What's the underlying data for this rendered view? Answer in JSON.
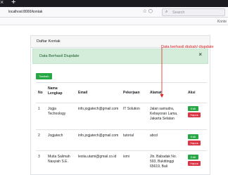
{
  "browser": {
    "tab_close": "×",
    "new_tab": "+",
    "url": "localhost:8000/kontak",
    "search_placeholder": "Search",
    "bookmark_label": "Konte",
    "url_icons": "☆ ⬡"
  },
  "page": {
    "card_title": "Daftar Kontak",
    "alert_text": "Data Berhasil Diupdate",
    "alert_close": "×",
    "add_button": "Tambah",
    "columns": [
      "No",
      "Nama Lengkap",
      "Email",
      "Pekerjaan",
      "Alamat",
      "Aksi"
    ],
    "rows": [
      {
        "no": "1",
        "nama": [
          "Jogja",
          "Technology"
        ],
        "email": "info.jogjatech@gmail.com",
        "pekerjaan": "IT Solution",
        "alamat": [
          "Jalan samudra,",
          "Kebayoran Lama,",
          "Jakarta Selatan"
        ],
        "edit": "Edit",
        "hapus": "Hapus"
      },
      {
        "no": "2",
        "nama": [
          "Jogjatech"
        ],
        "email": "info.jogjatech@gmail.com",
        "pekerjaan": "tutorial",
        "alamat": [
          "abcd"
        ],
        "edit": "Edit",
        "hapus": "Hapus"
      },
      {
        "no": "3",
        "nama": [
          "Mutia Salimah",
          "Nasyiah S.E."
        ],
        "email": "lestia.utami@gmail.co.id",
        "pekerjaan": "ismi",
        "alamat": [
          "Jln. Babadak No.",
          "593, Bukittinggi",
          "65619, Bali"
        ],
        "edit": "Edit",
        "hapus": "Hapus"
      }
    ]
  },
  "annotation": {
    "text": "Data berhasil diubah/ diupdate",
    "color": "#e02424"
  },
  "colors": {
    "success": "#28a745",
    "danger": "#dc3545",
    "alert_bg": "#d4edda",
    "alert_text": "#155724"
  }
}
